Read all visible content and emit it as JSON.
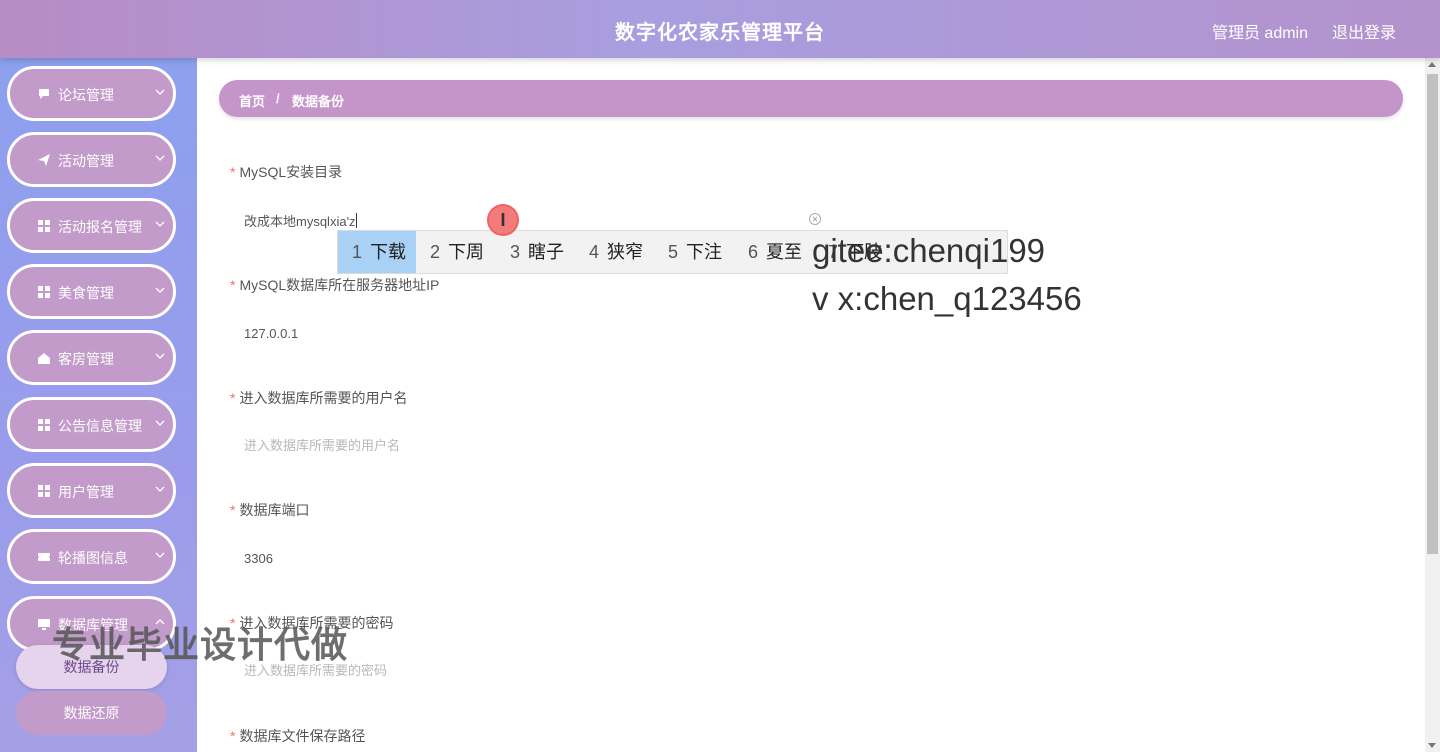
{
  "header": {
    "title": "数字化农家乐管理平台",
    "user": "管理员 admin",
    "logout": "退出登录"
  },
  "sidebar": {
    "items": [
      {
        "label": "论坛管理",
        "icon": "chat-icon"
      },
      {
        "label": "活动管理",
        "icon": "send-icon"
      },
      {
        "label": "活动报名管理",
        "icon": "grid-icon"
      },
      {
        "label": "美食管理",
        "icon": "grid-icon"
      },
      {
        "label": "客房管理",
        "icon": "house-icon"
      },
      {
        "label": "公告信息管理",
        "icon": "grid-icon"
      },
      {
        "label": "用户管理",
        "icon": "grid-icon"
      },
      {
        "label": "轮播图信息",
        "icon": "ticket-icon"
      },
      {
        "label": "数据库管理",
        "icon": "monitor-icon"
      }
    ],
    "sub_items": [
      "数据备份",
      "数据还原"
    ]
  },
  "breadcrumb": {
    "home": "首页",
    "sep": "/",
    "current": "数据备份"
  },
  "form": {
    "fields": [
      {
        "label": "MySQL安装目录",
        "value": "改成本地mysqlxia'z"
      },
      {
        "label": "MySQL数据库所在服务器地址IP",
        "value": "127.0.0.1"
      },
      {
        "label": "进入数据库所需要的用户名",
        "placeholder": "进入数据库所需要的用户名"
      },
      {
        "label": "数据库端口",
        "value": "3306"
      },
      {
        "label": "进入数据库所需要的密码",
        "placeholder": "进入数据库所需要的密码"
      },
      {
        "label": "数据库文件保存路径"
      }
    ]
  },
  "ime": {
    "candidates": [
      {
        "n": "1",
        "text": "下载"
      },
      {
        "n": "2",
        "text": "下周"
      },
      {
        "n": "3",
        "text": "瞎子"
      },
      {
        "n": "4",
        "text": "狭窄"
      },
      {
        "n": "5",
        "text": "下注"
      },
      {
        "n": "6",
        "text": "夏至"
      },
      {
        "n": "7",
        "text": "下肢"
      }
    ]
  },
  "cursor_glyph": "I",
  "watermarks": {
    "line1": "gitee:chenqi199",
    "line2": "v x:chen_q123456",
    "line3": "专业毕业设计代做"
  },
  "colors": {
    "header_gradient": [
      "#b88cc4",
      "#a89ee0",
      "#b492cc"
    ],
    "sidebar": "#8da0ee",
    "menu_item": "#c39bca",
    "breadcrumb": "#c395c8",
    "required_star": "#f56c6c",
    "ime_selected": "#a9d0f5"
  }
}
